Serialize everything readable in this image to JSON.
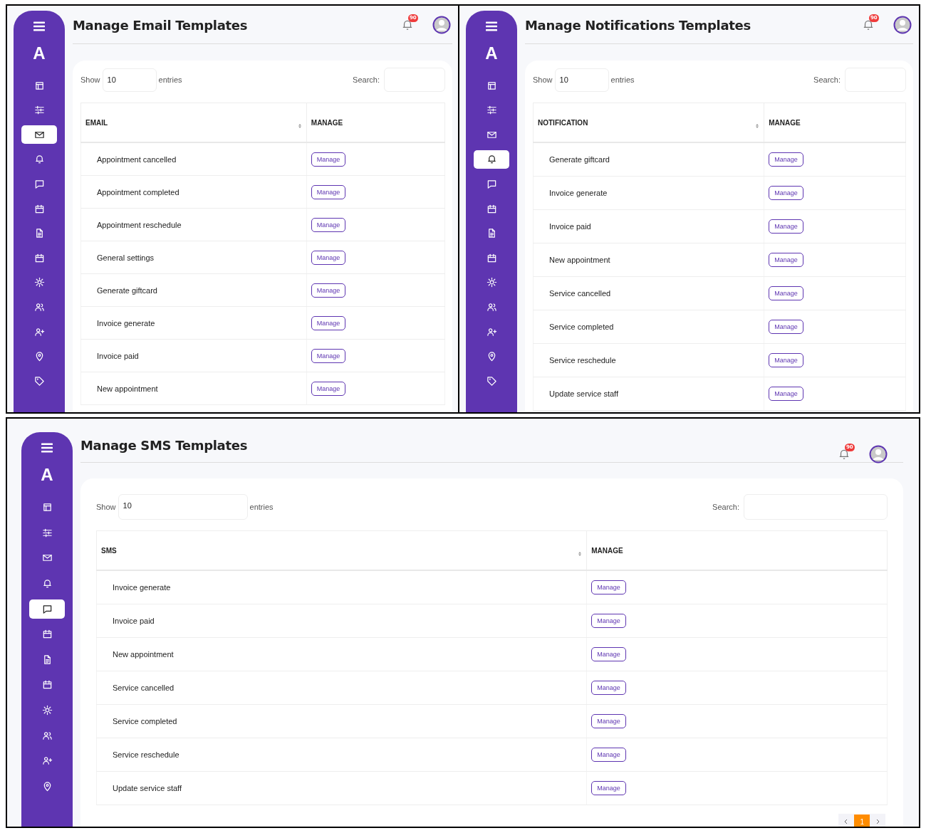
{
  "panels": [
    {
      "title": "Manage Email Templates",
      "notification_count": "90",
      "logo": "A",
      "sidebar": {
        "items": [
          {
            "kind": "layout",
            "selected": false
          },
          {
            "kind": "sliders",
            "selected": false
          },
          {
            "kind": "mail",
            "selected": true
          },
          {
            "kind": "bell",
            "selected": false
          },
          {
            "kind": "chat",
            "selected": false
          },
          {
            "kind": "calendar",
            "selected": false
          },
          {
            "kind": "document",
            "selected": false
          },
          {
            "kind": "calendar",
            "selected": false
          },
          {
            "kind": "gear",
            "selected": false
          },
          {
            "kind": "users",
            "selected": false
          },
          {
            "kind": "user-plus",
            "selected": false
          },
          {
            "kind": "pin",
            "selected": false
          },
          {
            "kind": "tag",
            "selected": false
          }
        ]
      },
      "show_label": "Show",
      "page_size": "10",
      "entries_label": "entries",
      "search_label": "Search:",
      "table": {
        "columns": [
          "EMAIL",
          "MANAGE"
        ],
        "rows": [
          {
            "name": "Appointment cancelled",
            "action": "Manage"
          },
          {
            "name": "Appointment completed",
            "action": "Manage"
          },
          {
            "name": "Appointment reschedule",
            "action": "Manage"
          },
          {
            "name": "General settings",
            "action": "Manage"
          },
          {
            "name": "Generate giftcard",
            "action": "Manage"
          },
          {
            "name": "Invoice generate",
            "action": "Manage"
          },
          {
            "name": "Invoice paid",
            "action": "Manage"
          },
          {
            "name": "New appointment",
            "action": "Manage"
          }
        ]
      }
    },
    {
      "title": "Manage Notifications Templates",
      "notification_count": "90",
      "logo": "A",
      "sidebar": {
        "items": [
          {
            "kind": "layout",
            "selected": false
          },
          {
            "kind": "sliders",
            "selected": false
          },
          {
            "kind": "mail",
            "selected": false
          },
          {
            "kind": "bell",
            "selected": true
          },
          {
            "kind": "chat",
            "selected": false
          },
          {
            "kind": "calendar",
            "selected": false
          },
          {
            "kind": "document",
            "selected": false
          },
          {
            "kind": "calendar",
            "selected": false
          },
          {
            "kind": "gear",
            "selected": false
          },
          {
            "kind": "users",
            "selected": false
          },
          {
            "kind": "user-plus",
            "selected": false
          },
          {
            "kind": "pin",
            "selected": false
          },
          {
            "kind": "tag",
            "selected": false
          }
        ]
      },
      "show_label": "Show",
      "page_size": "10",
      "entries_label": "entries",
      "search_label": "Search:",
      "table": {
        "columns": [
          "NOTIFICATION",
          "MANAGE"
        ],
        "rows": [
          {
            "name": "Generate giftcard",
            "action": "Manage"
          },
          {
            "name": "Invoice generate",
            "action": "Manage"
          },
          {
            "name": "Invoice paid",
            "action": "Manage"
          },
          {
            "name": "New appointment",
            "action": "Manage"
          },
          {
            "name": "Service cancelled",
            "action": "Manage"
          },
          {
            "name": "Service completed",
            "action": "Manage"
          },
          {
            "name": "Service reschedule",
            "action": "Manage"
          },
          {
            "name": "Update service staff",
            "action": "Manage"
          }
        ]
      }
    },
    {
      "title": "Manage SMS Templates",
      "notification_count": "90",
      "logo": "A",
      "sidebar": {
        "items": [
          {
            "kind": "layout",
            "selected": false
          },
          {
            "kind": "sliders",
            "selected": false
          },
          {
            "kind": "mail",
            "selected": false
          },
          {
            "kind": "bell",
            "selected": false
          },
          {
            "kind": "chat",
            "selected": true
          },
          {
            "kind": "calendar",
            "selected": false
          },
          {
            "kind": "document",
            "selected": false
          },
          {
            "kind": "calendar",
            "selected": false
          },
          {
            "kind": "gear",
            "selected": false
          },
          {
            "kind": "users",
            "selected": false
          },
          {
            "kind": "user-plus",
            "selected": false
          },
          {
            "kind": "pin",
            "selected": false
          }
        ]
      },
      "show_label": "Show",
      "page_size": "10",
      "entries_label": "entries",
      "search_label": "Search:",
      "table": {
        "columns": [
          "SMS",
          "MANAGE"
        ],
        "rows": [
          {
            "name": "Invoice generate",
            "action": "Manage"
          },
          {
            "name": "Invoice paid",
            "action": "Manage"
          },
          {
            "name": "New appointment",
            "action": "Manage"
          },
          {
            "name": "Service cancelled",
            "action": "Manage"
          },
          {
            "name": "Service completed",
            "action": "Manage"
          },
          {
            "name": "Service reschedule",
            "action": "Manage"
          },
          {
            "name": "Update service staff",
            "action": "Manage"
          }
        ]
      },
      "pagination": {
        "pages": [
          {
            "label": "1",
            "selected": true
          }
        ]
      }
    }
  ]
}
